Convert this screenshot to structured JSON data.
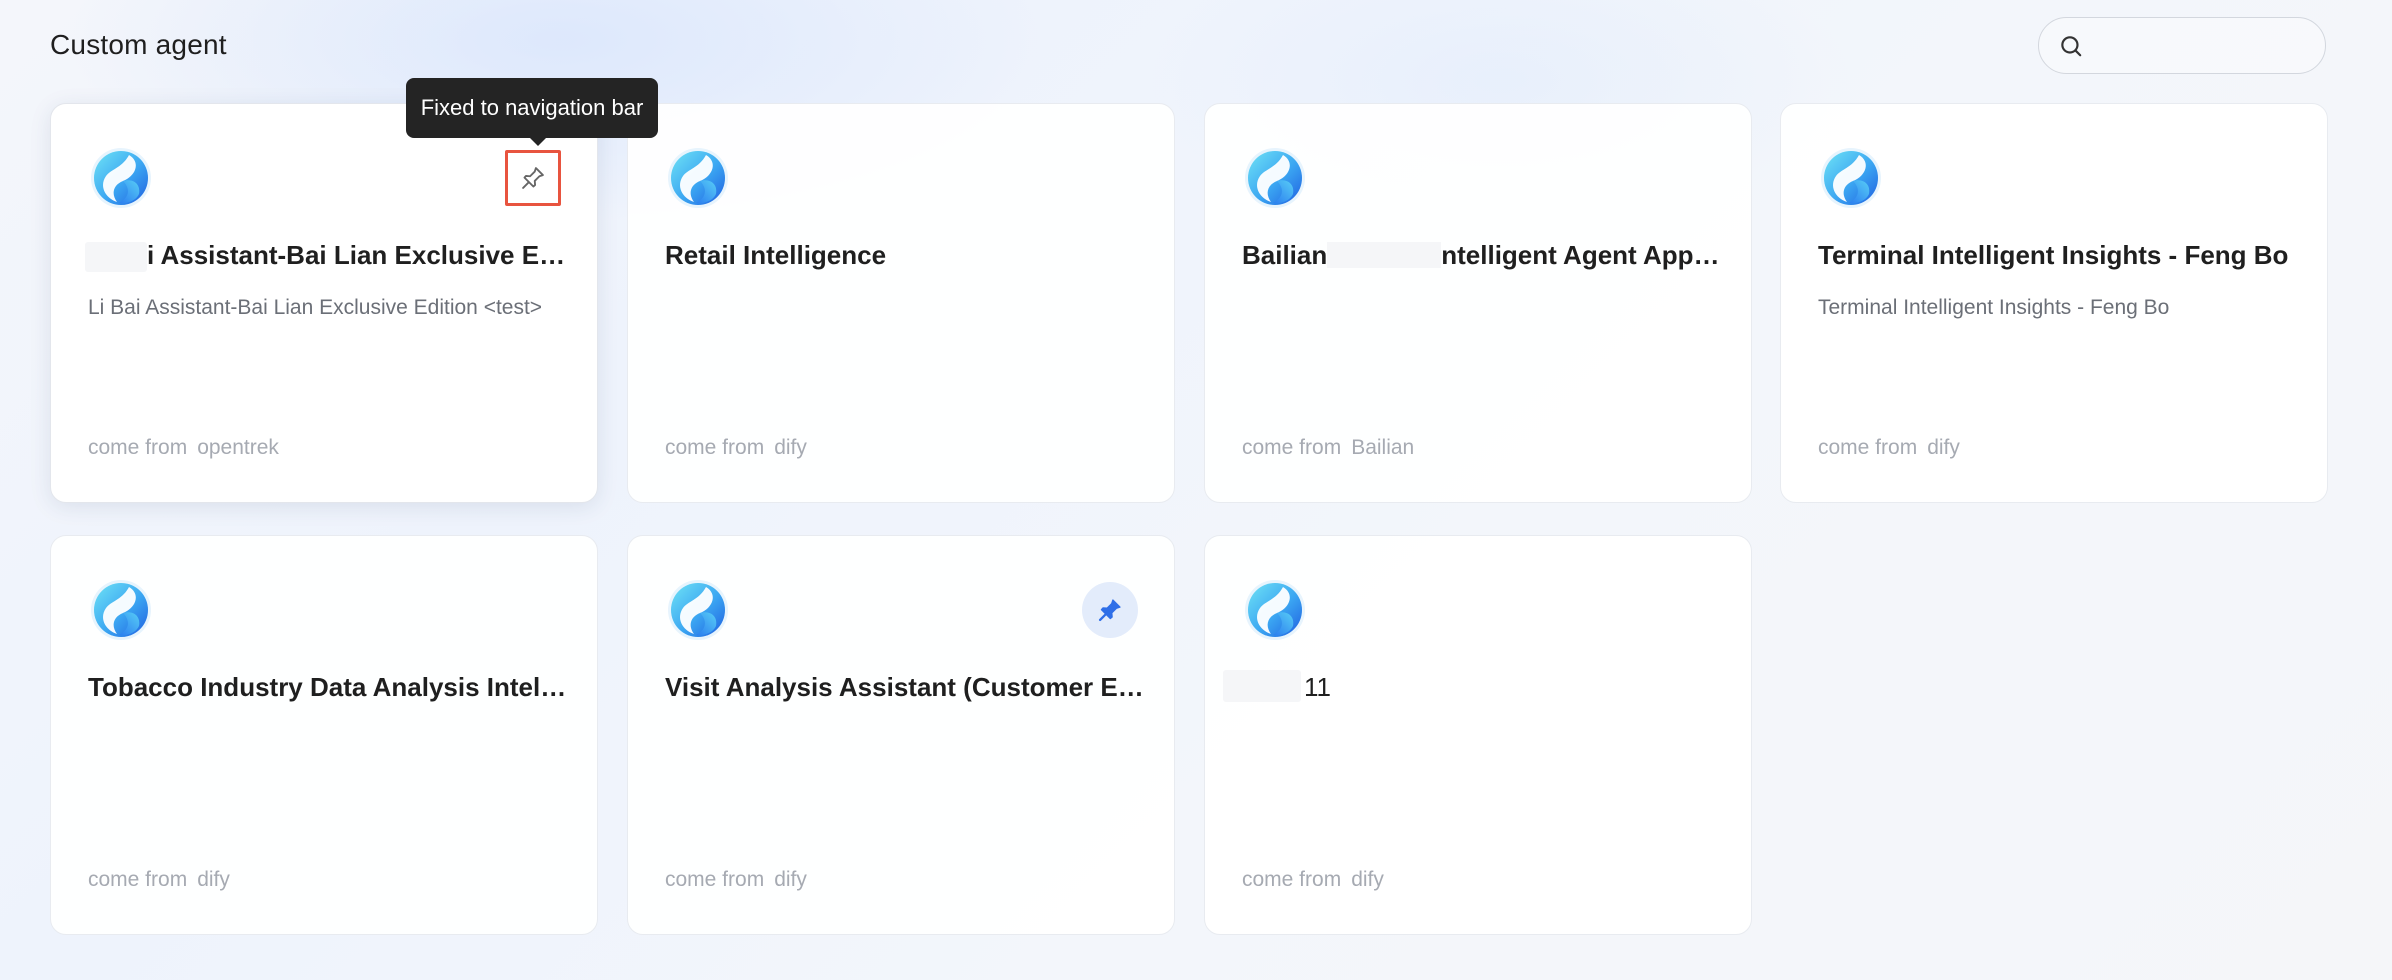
{
  "page": {
    "title": "Custom agent"
  },
  "search": {
    "placeholder": ""
  },
  "tooltip": {
    "text": "Fixed to navigation bar"
  },
  "source_label": "come from",
  "cards": [
    {
      "title": "i Assistant-Bai Lian Exclusive Edi...",
      "description": "Li Bai Assistant-Bai Lian Exclusive Edition <test>",
      "source": "opentrek",
      "pin_state": "hover"
    },
    {
      "title": "Retail Intelligence",
      "description": "",
      "source": "dify",
      "pin_state": "none"
    },
    {
      "title": "Bailian",
      "title_tail": "ntelligent Agent Applic...",
      "description": "",
      "source": "Bailian",
      "pin_state": "none"
    },
    {
      "title": "Terminal Intelligent Insights - Feng Bo",
      "description": "Terminal Intelligent Insights - Feng Bo",
      "source": "dify",
      "pin_state": "none"
    },
    {
      "title": "Tobacco Industry Data Analysis Intellig...",
      "description": "",
      "source": "dify",
      "pin_state": "none"
    },
    {
      "title": "Visit Analysis Assistant (Customer Exp...",
      "description": "",
      "source": "dify",
      "pin_state": "pinned"
    },
    {
      "title": "11",
      "description": "",
      "source": "dify",
      "pin_state": "none"
    }
  ],
  "colors": {
    "accent": "#2f6fe8",
    "highlight_outline": "#e8543f",
    "tooltip_bg": "#242424"
  },
  "icons": {
    "search": "search-icon",
    "pin": "pushpin-icon",
    "logo": "agent-logo-icon"
  }
}
